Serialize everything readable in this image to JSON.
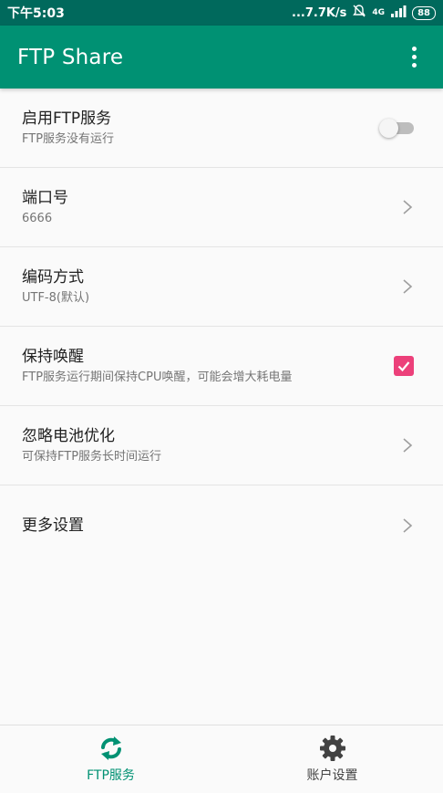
{
  "status_bar": {
    "time": "下午5:03",
    "speed": "...7.7K/s",
    "network": "4G",
    "battery": "88"
  },
  "app_bar": {
    "title": "FTP Share",
    "menu_icon": "more-vert-icon"
  },
  "settings": [
    {
      "title": "启用FTP服务",
      "subtitle": "FTP服务没有运行",
      "control": "switch",
      "checked": false
    },
    {
      "title": "端口号",
      "subtitle": "6666",
      "control": "chevron"
    },
    {
      "title": "编码方式",
      "subtitle": "UTF-8(默认)",
      "control": "chevron"
    },
    {
      "title": "保持唤醒",
      "subtitle": "FTP服务运行期间保持CPU唤醒，可能会增大耗电量",
      "control": "checkbox",
      "checked": true
    },
    {
      "title": "忽略电池优化",
      "subtitle": "可保持FTP服务长时间运行",
      "control": "chevron"
    },
    {
      "title": "更多设置",
      "subtitle": "",
      "control": "chevron"
    }
  ],
  "bottom_nav": {
    "items": [
      {
        "label": "FTP服务",
        "icon": "sync-icon",
        "active": true
      },
      {
        "label": "账户设置",
        "icon": "gear-icon",
        "active": false
      }
    ]
  },
  "colors": {
    "status_bar": "#00695c",
    "app_bar": "#009173",
    "accent_checkbox": "#ec407a",
    "active_nav": "#009173"
  }
}
